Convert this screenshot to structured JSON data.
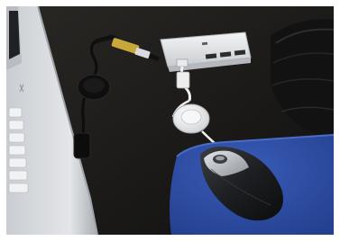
{
  "scene": {
    "colors": {
      "frame": "#ffffff",
      "desk": "#1b1a18",
      "laptop": "#d9dcdf",
      "laptop_edge": "#9ea3a8",
      "hub": "#e7e8ea",
      "mousepad": "#2f4fa8",
      "mouse_body": "#1d1f22",
      "mouse_silver": "#b9bec4",
      "cable_white": "#f2f2f2",
      "cable_black": "#0d0d0d",
      "case": "#141414"
    },
    "objects": [
      "laptop-keyboard",
      "usb-hub",
      "usb-connector",
      "black-retractable-reel",
      "white-retractable-reel",
      "blue-mousepad",
      "optical-mouse",
      "black-case"
    ]
  }
}
